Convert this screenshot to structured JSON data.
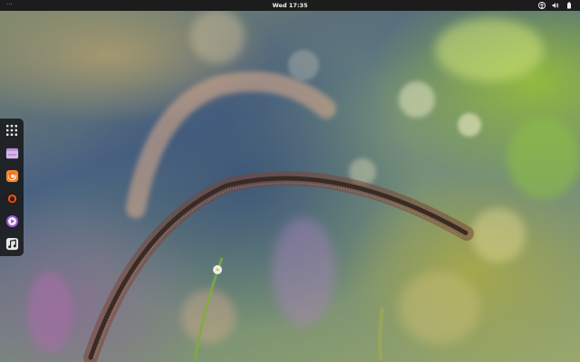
{
  "topbar": {
    "activities_label": "···",
    "clock": "Wed 17:35",
    "tray_icons": [
      "accessibility-icon",
      "volume-icon",
      "battery-icon"
    ]
  },
  "dash": {
    "items": [
      {
        "name": "show-apps",
        "icon": "grid-icon"
      },
      {
        "name": "files",
        "icon": "folder-icon",
        "color": "#b98ed6"
      },
      {
        "name": "firefox",
        "icon": "firefox-icon",
        "color": "#f3872c"
      },
      {
        "name": "ubuntu-software",
        "icon": "software-center-icon",
        "color": "#e2551f"
      },
      {
        "name": "totem-videos",
        "icon": "video-player-icon",
        "color": "#9b59d0"
      },
      {
        "name": "music",
        "icon": "music-icon",
        "color": "#e8e8e8"
      }
    ]
  },
  "colors": {
    "topbar_bg": "#1c1c1c",
    "dash_bg": "#141414"
  }
}
